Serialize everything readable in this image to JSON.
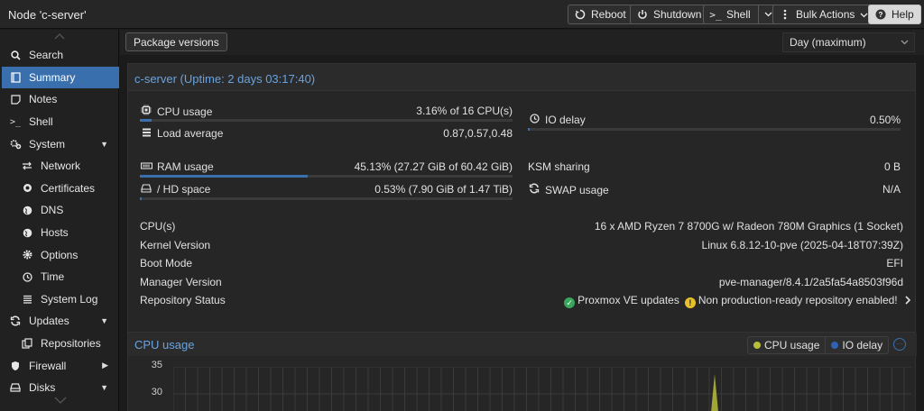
{
  "window": {
    "title": "Node 'c-server'"
  },
  "toolbar": {
    "reboot_label": "Reboot",
    "shutdown_label": "Shutdown",
    "shell_label": "Shell",
    "bulk_actions_label": "Bulk Actions",
    "help_label": "Help"
  },
  "sidebar": {
    "items": [
      {
        "label": "Search",
        "icon": "search-icon"
      },
      {
        "label": "Summary",
        "icon": "summary-icon",
        "active": true
      },
      {
        "label": "Notes",
        "icon": "notes-icon"
      },
      {
        "label": "Shell",
        "icon": "terminal-icon"
      },
      {
        "label": "System",
        "icon": "cogs-icon",
        "expandable": true
      },
      {
        "label": "Network",
        "icon": "network-icon"
      },
      {
        "label": "Certificates",
        "icon": "certificate-icon"
      },
      {
        "label": "DNS",
        "icon": "globe-icon"
      },
      {
        "label": "Hosts",
        "icon": "globe-icon"
      },
      {
        "label": "Options",
        "icon": "gear-icon"
      },
      {
        "label": "Time",
        "icon": "clock-icon"
      },
      {
        "label": "System Log",
        "icon": "list-icon"
      },
      {
        "label": "Updates",
        "icon": "refresh-icon",
        "expandable": true
      },
      {
        "label": "Repositories",
        "icon": "repositories-icon"
      },
      {
        "label": "Firewall",
        "icon": "shield-icon",
        "collapsed": true
      },
      {
        "label": "Disks",
        "icon": "disks-icon",
        "expandable": true
      }
    ]
  },
  "content": {
    "package_versions_label": "Package versions",
    "timeframe": "Day (maximum)"
  },
  "summary": {
    "title": "c-server (Uptime: 2 days 03:17:40)",
    "cpu_usage": {
      "label": "CPU usage",
      "value": "3.16% of 16 CPU(s)",
      "percent": 3.16
    },
    "load_average": {
      "label": "Load average",
      "value": "0.87,0.57,0.48"
    },
    "io_delay": {
      "label": "IO delay",
      "value": "0.50%",
      "percent": 0.5
    },
    "ram_usage": {
      "label": "RAM usage",
      "value": "45.13% (27.27 GiB of 60.42 GiB)",
      "percent": 45.13
    },
    "hd_space": {
      "label": "/ HD space",
      "value": "0.53% (7.90 GiB of 1.47 TiB)",
      "percent": 0.53
    },
    "ksm_sharing": {
      "label": "KSM sharing",
      "value": "0 B"
    },
    "swap_usage": {
      "label": "SWAP usage",
      "value": "N/A"
    },
    "info": [
      {
        "label": "CPU(s)",
        "value": "16 x AMD Ryzen 7 8700G w/ Radeon 780M Graphics (1 Socket)"
      },
      {
        "label": "Kernel Version",
        "value": "Linux 6.8.12-10-pve (2025-04-18T07:39Z)"
      },
      {
        "label": "Boot Mode",
        "value": "EFI"
      },
      {
        "label": "Manager Version",
        "value": "pve-manager/8.4.1/2a5fa54a8503f96d"
      }
    ],
    "repository_status": {
      "label": "Repository Status",
      "ok_text": "Proxmox VE updates",
      "warn_text": "Non production-ready repository enabled!"
    }
  },
  "cpu_chart": {
    "title": "CPU usage",
    "legend": [
      {
        "name": "CPU usage",
        "color": "#b8bd3a"
      },
      {
        "name": "IO delay",
        "color": "#2f62b3"
      }
    ],
    "yticks": [
      "35",
      "30"
    ]
  },
  "chart_data": {
    "type": "area",
    "title": "CPU usage",
    "series": [
      {
        "name": "CPU usage",
        "color": "#b8bd3a"
      },
      {
        "name": "IO delay",
        "color": "#2f62b3"
      }
    ],
    "yticks": [
      35,
      30
    ]
  },
  "colors": {
    "accent": "#3a6fae",
    "title_blue": "#6aa3de",
    "ok": "#3aa55c",
    "warn": "#e6c02a"
  }
}
